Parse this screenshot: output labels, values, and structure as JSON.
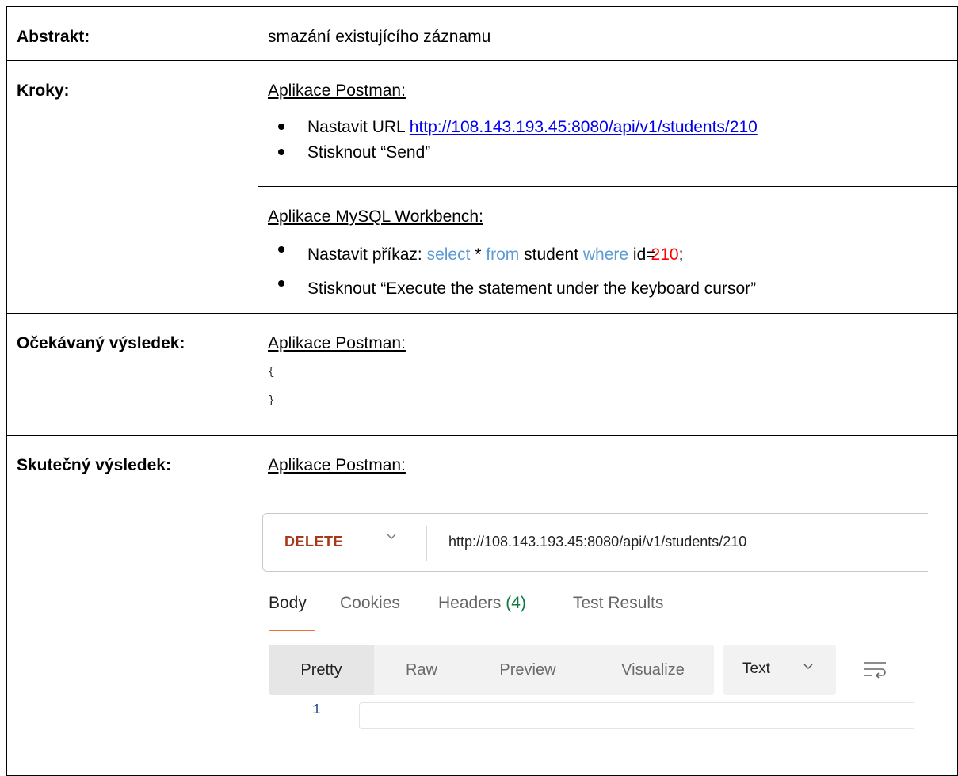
{
  "rows": {
    "abstract": {
      "label": "Abstrakt:",
      "value": "smazání existujícího záznamu"
    },
    "steps": {
      "label": "Kroky:",
      "postman": {
        "heading": "Aplikace Postman:",
        "bullet1_prefix": "Nastavit URL",
        "bullet1_link": "http://108.143.193.45:8080/api/v1/students/210",
        "bullet2": "Stisknout “Send”"
      },
      "mysql": {
        "heading": "Aplikace MySQL Workbench:",
        "bullet1_prefix": "Nastavit příkaz:",
        "kw_select": "select",
        "star": "*",
        "kw_from": "from",
        "table": "student",
        "kw_where": "where",
        "cond": "id=",
        "id_value": "210",
        "semicolon": ";",
        "bullet2": "Stisknout “Execute the statement under the keyboard cursor”"
      }
    },
    "expected": {
      "label": "Očekávaný výsledek:",
      "heading": "Aplikace Postman:",
      "json_open": "{",
      "json_close": "}"
    },
    "actual": {
      "label": "Skutečný výsledek:",
      "heading": "Aplikace Postman:"
    }
  },
  "postman": {
    "method": "DELETE",
    "url": "http://108.143.193.45:8080/api/v1/students/210",
    "tabs": {
      "body": "Body",
      "cookies": "Cookies",
      "headers": "Headers",
      "headers_count": "(4)",
      "test_results": "Test Results",
      "active": "Body"
    },
    "view_modes": [
      "Pretty",
      "Raw",
      "Preview",
      "Visualize"
    ],
    "active_view_mode": "Pretty",
    "format": "Text",
    "line_number": "1",
    "colors": {
      "method": "#a8381a",
      "active_tab_underline": "#f26b3a",
      "headers_count": "#0d7a3e"
    },
    "icons": [
      "chevron-down-icon",
      "wrap-lines-icon"
    ]
  }
}
